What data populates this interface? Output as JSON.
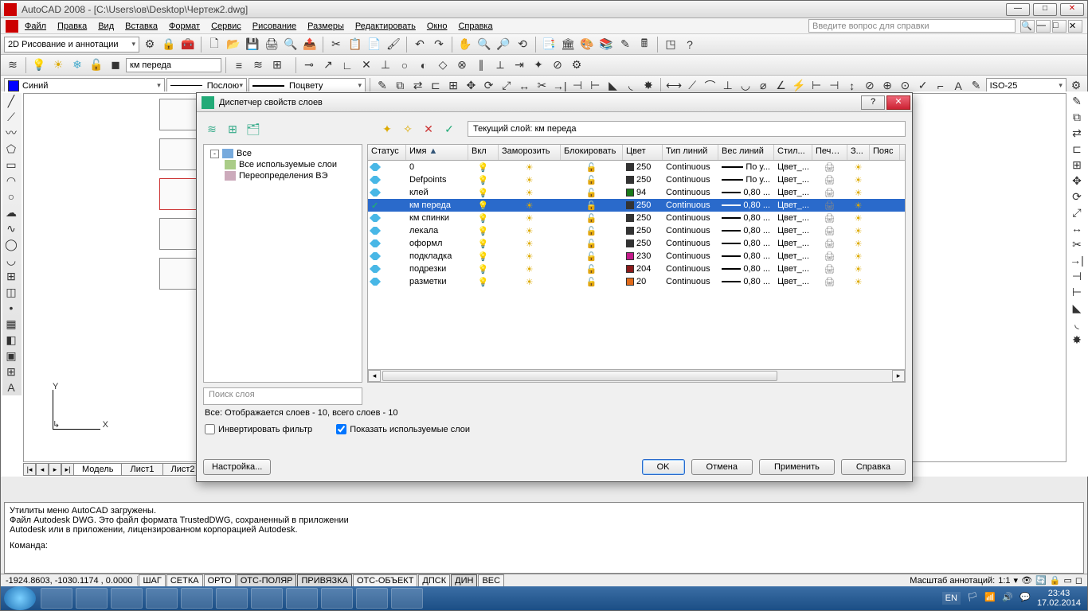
{
  "app": {
    "title": "AutoCAD 2008 - [C:\\Users\\ов\\Desktop\\Чертеж2.dwg]",
    "help_placeholder": "Введите вопрос для справки"
  },
  "menu": {
    "file": "Файл",
    "edit": "Правка",
    "view": "Вид",
    "insert": "Вставка",
    "format": "Формат",
    "service": "Сервис",
    "draw": "Рисование",
    "dim": "Размеры",
    "modify": "Редактировать",
    "window": "Окно",
    "help": "Справка"
  },
  "workspace_combo": "2D Рисование и аннотации",
  "layer_combo_main": "км переда",
  "color_combo": "Синий",
  "bylayer": "Послою",
  "bycolor": "Поцвету",
  "iso": "ISO-25",
  "tabs": {
    "model": "Модель",
    "l1": "Лист1",
    "l2": "Лист2"
  },
  "cmd": {
    "l1": "Утилиты меню AutoCAD загружены.",
    "l2": "Файл Autodesk DWG. Это файл формата TrustedDWG, сохраненный в приложении",
    "l3": "Autodesk или в приложении, лицензированном корпорацией Autodesk.",
    "prompt": "Команда:"
  },
  "status": {
    "coord": "-1924.8603, -1030.1174 , 0.0000",
    "snap": "ШАГ",
    "grid": "СЕТКА",
    "ortho": "ОРТО",
    "polar": "ОТС-ПОЛЯР",
    "osnap": "ПРИВЯЗКА",
    "otrack": "ОТС-ОБЪЕКТ",
    "dyn1": "ДПСК",
    "dyn": "ДИН",
    "lwt": "ВЕС",
    "annoscale_label": "Масштаб аннотаций:",
    "annoscale": "1:1"
  },
  "taskbar": {
    "lang": "EN",
    "time": "23:43",
    "date": "17.02.2014"
  },
  "dialog": {
    "title": "Диспетчер свойств слоев",
    "current_label": "Текущий слой: км переда",
    "tree": {
      "all": "Все",
      "used": "Все используемые слои",
      "override": "Переопределения ВЭ"
    },
    "columns": {
      "status": "Статус",
      "name": "Имя",
      "on": "Вкл",
      "freeze": "Заморозить",
      "lock": "Блокировать",
      "color": "Цвет",
      "ltype": "Тип линий",
      "lweight": "Вес линий",
      "pstyle": "Стил...",
      "plot": "Печать",
      "z": "З...",
      "desc": "Пояс"
    },
    "rows": [
      {
        "name": "0",
        "color": "250",
        "colhex": "#333",
        "ltype": "Continuous",
        "lw": "По у...",
        "ps": "Цвет_...",
        "current": false
      },
      {
        "name": "Defpoints",
        "color": "250",
        "colhex": "#333",
        "ltype": "Continuous",
        "lw": "По у...",
        "ps": "Цвет_...",
        "current": false
      },
      {
        "name": "клей",
        "color": "94",
        "colhex": "#1a7a1a",
        "ltype": "Continuous",
        "lw": "0,80 ...",
        "ps": "Цвет_...",
        "current": false
      },
      {
        "name": "км переда",
        "color": "250",
        "colhex": "#333",
        "ltype": "Continuous",
        "lw": "0,80 ...",
        "ps": "Цвет_...",
        "current": true
      },
      {
        "name": "км спинки",
        "color": "250",
        "colhex": "#333",
        "ltype": "Continuous",
        "lw": "0,80 ...",
        "ps": "Цвет_...",
        "current": false
      },
      {
        "name": "лекала",
        "color": "250",
        "colhex": "#333",
        "ltype": "Continuous",
        "lw": "0,80 ...",
        "ps": "Цвет_...",
        "current": false
      },
      {
        "name": "оформл",
        "color": "250",
        "colhex": "#333",
        "ltype": "Continuous",
        "lw": "0,80 ...",
        "ps": "Цвет_...",
        "current": false
      },
      {
        "name": "подкладка",
        "color": "230",
        "colhex": "#c31b8a",
        "ltype": "Continuous",
        "lw": "0,80 ...",
        "ps": "Цвет_...",
        "current": false
      },
      {
        "name": "подрезки",
        "color": "204",
        "colhex": "#8a1a1a",
        "ltype": "Continuous",
        "lw": "0,80 ...",
        "ps": "Цвет_...",
        "current": false
      },
      {
        "name": "разметки",
        "color": "20",
        "colhex": "#e06a1a",
        "ltype": "Continuous",
        "lw": "0,80 ...",
        "ps": "Цвет_...",
        "current": false
      }
    ],
    "search_placeholder": "Поиск слоя",
    "status_line": "Все: Отображается слоев - 10, всего слоев - 10",
    "invert": "Инвертировать фильтр",
    "showused": "Показать используемые слои",
    "settings": "Настройка...",
    "ok": "OK",
    "cancel": "Отмена",
    "apply": "Применить",
    "helpbtn": "Справка"
  }
}
